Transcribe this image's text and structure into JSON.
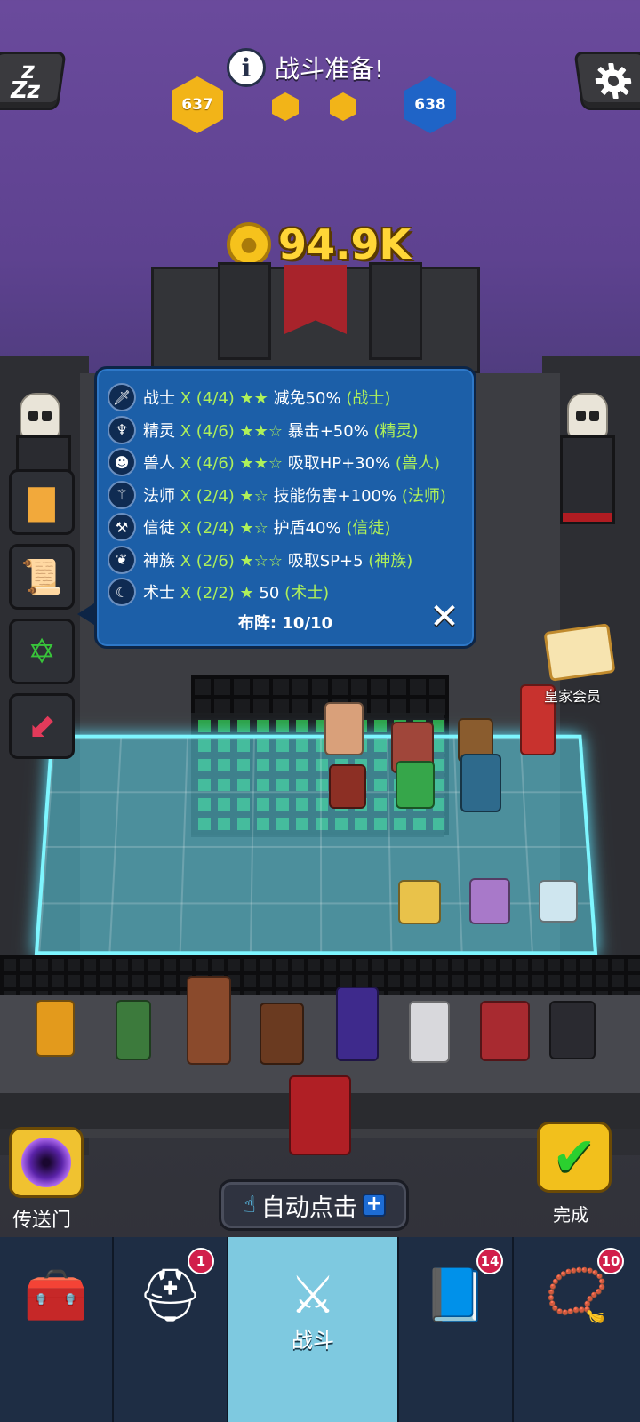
{
  "header": {
    "phase_title": "战斗准备!",
    "left_score": "637",
    "right_score": "638"
  },
  "gold": {
    "amount": "94.9K"
  },
  "synergy_panel": {
    "rows": [
      {
        "icon": "sword-icon",
        "name": "战士",
        "count": "X (4/4)",
        "stars": "★★",
        "effect": "减免50%",
        "tag": "(战士)"
      },
      {
        "icon": "elf-icon",
        "name": "精灵",
        "count": "X (4/6)",
        "stars": "★★☆",
        "effect": "暴击+50%",
        "tag": "(精灵)"
      },
      {
        "icon": "orc-icon",
        "name": "兽人",
        "count": "X (4/6)",
        "stars": "★★☆",
        "effect": "吸取HP+30%",
        "tag": "(兽人)"
      },
      {
        "icon": "wand-icon",
        "name": "法师",
        "count": "X (2/4)",
        "stars": "★☆",
        "effect": "技能伤害+100%",
        "tag": "(法师)"
      },
      {
        "icon": "hammer-icon",
        "name": "信徒",
        "count": "X (2/4)",
        "stars": "★☆",
        "effect": "护盾40%",
        "tag": "(信徒)"
      },
      {
        "icon": "wings-icon",
        "name": "神族",
        "count": "X (2/6)",
        "stars": "★☆☆",
        "effect": "吸取SP+5",
        "tag": "(神族)"
      },
      {
        "icon": "warlock-icon",
        "name": "术士",
        "count": "X (2/2)",
        "stars": "★",
        "effect": "50",
        "tag": "(术士)"
      }
    ],
    "formation_label": "布阵:",
    "formation_value": "10/10"
  },
  "royal_member": {
    "label": "皇家会员"
  },
  "bottom_controls": {
    "portal_label": "传送门",
    "done_label": "完成",
    "auto_click_label": "自动点击"
  },
  "tabs": [
    {
      "icon": "treasure-chest-icon",
      "label": "",
      "badge": ""
    },
    {
      "icon": "viking-helmet-icon",
      "label": "",
      "badge": "1"
    },
    {
      "icon": "crossed-swords-icon",
      "label": "战斗",
      "badge": ""
    },
    {
      "icon": "spellbook-icon",
      "label": "",
      "badge": "14"
    },
    {
      "icon": "amulet-icon",
      "label": "",
      "badge": "10"
    }
  ],
  "colors": {
    "panel_blue": "#1c5fa8",
    "highlight_green": "#aef05a",
    "gold": "#ffd637",
    "board_cyan": "#7ef6ff",
    "active_tab": "#7ec9e0"
  }
}
